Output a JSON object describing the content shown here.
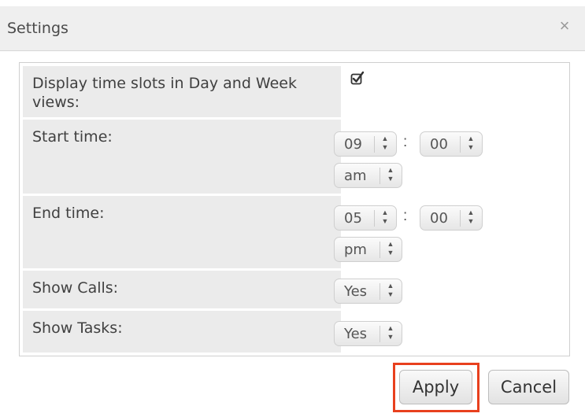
{
  "dialog": {
    "title": "Settings",
    "close_glyph": "×"
  },
  "rows": {
    "display_slots": {
      "label": "Display time slots in Day and Week views:",
      "checked": true
    },
    "start_time": {
      "label": "Start time:",
      "hour": "09",
      "minute": "00",
      "meridiem": "am",
      "colon": ":"
    },
    "end_time": {
      "label": "End time:",
      "hour": "05",
      "minute": "00",
      "meridiem": "pm",
      "colon": ":"
    },
    "show_calls": {
      "label": "Show Calls:",
      "value": "Yes"
    },
    "show_tasks": {
      "label": "Show Tasks:",
      "value": "Yes"
    }
  },
  "buttons": {
    "apply": "Apply",
    "cancel": "Cancel"
  },
  "icons": {
    "select_arrows": "up-down-arrows-icon",
    "checkbox": "check-icon",
    "close": "close-icon"
  },
  "colors": {
    "highlight": "#e8401e",
    "header_bg": "#efefef",
    "label_bg": "#ebebeb"
  }
}
